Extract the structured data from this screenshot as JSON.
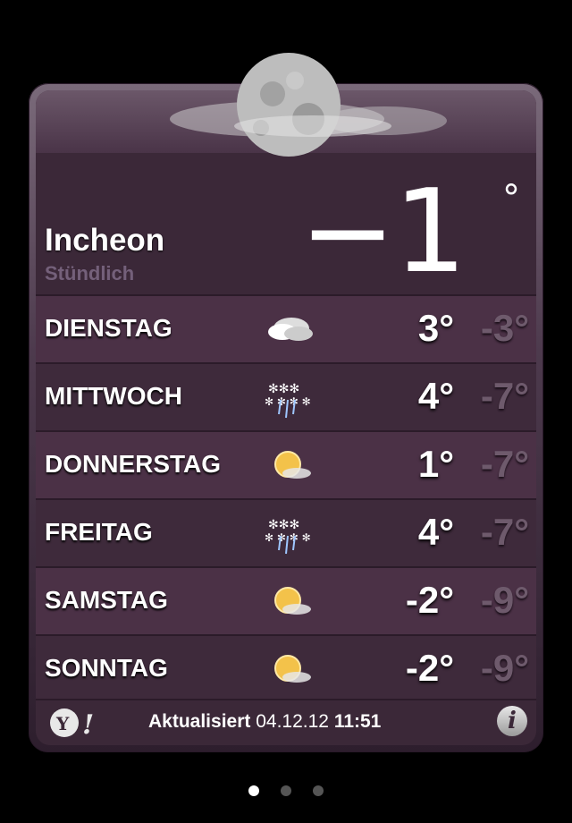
{
  "header": {
    "city": "Incheon",
    "subtitle": "Stündlich",
    "current_temp": "−1",
    "degree": "°"
  },
  "forecast": [
    {
      "day": "DIENSTAG",
      "icon": "cloudy-icon",
      "hi": "3°",
      "lo": "-3°"
    },
    {
      "day": "MITTWOCH",
      "icon": "snow-rain-icon",
      "hi": "4°",
      "lo": "-7°"
    },
    {
      "day": "DONNERSTAG",
      "icon": "sun-cloud-icon",
      "hi": "1°",
      "lo": "-7°"
    },
    {
      "day": "FREITAG",
      "icon": "snow-rain-icon",
      "hi": "4°",
      "lo": "-7°"
    },
    {
      "day": "SAMSTAG",
      "icon": "sun-cloud-icon",
      "hi": "-2°",
      "lo": "-9°"
    },
    {
      "day": "SONNTAG",
      "icon": "sun-cloud-icon",
      "hi": "-2°",
      "lo": "-9°"
    }
  ],
  "footer": {
    "updated_label": "Aktualisiert",
    "updated_date": "04.12.12",
    "updated_time": "11:51",
    "yahoo_icon": "yahoo-logo-icon",
    "info_icon": "info-icon",
    "info_glyph": "i"
  },
  "pagination": {
    "total": 3,
    "active": 1
  },
  "colors": {
    "background": "#000000",
    "card": "#3b2838",
    "row_odd": "#4b3146",
    "row_even": "#3e2a3b",
    "low_temp": "#6e5a6c"
  }
}
